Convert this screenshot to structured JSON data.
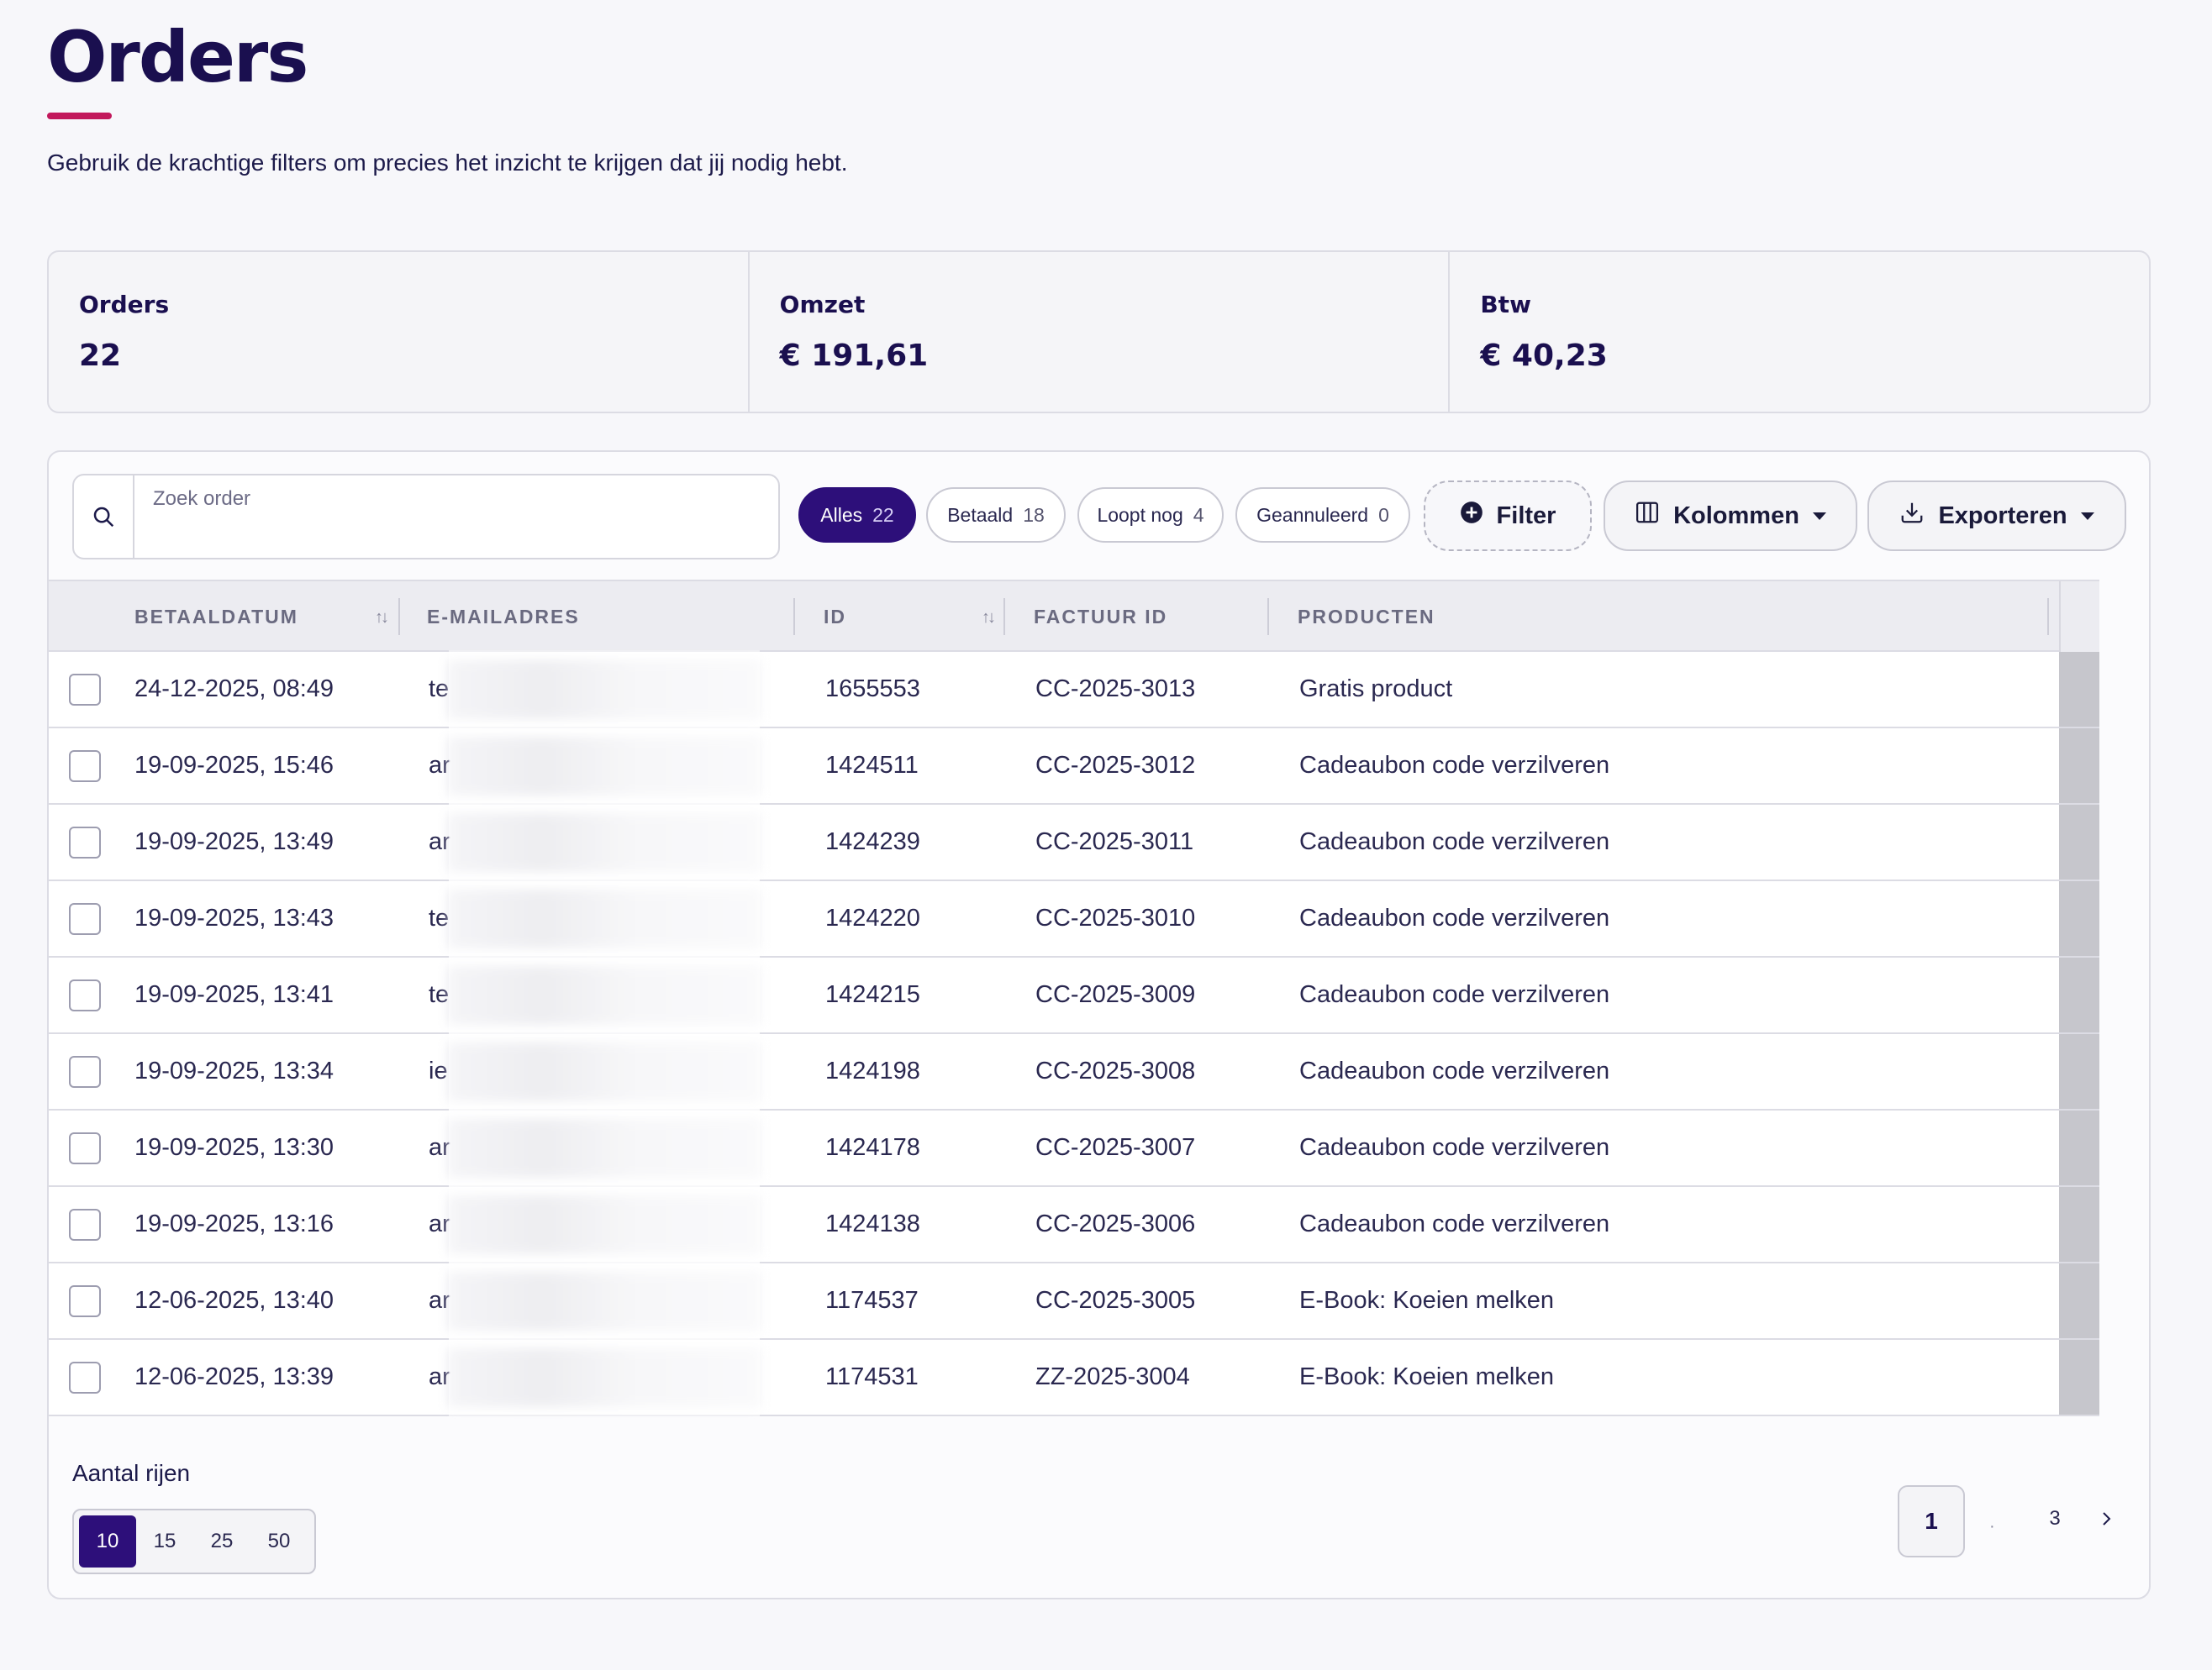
{
  "page": {
    "title": "Orders",
    "subtitle": "Gebruik de krachtige filters om precies het inzicht te krijgen dat jij nodig hebt."
  },
  "stats": [
    {
      "label": "Orders",
      "value": "22"
    },
    {
      "label": "Omzet",
      "value": "€ 191,61"
    },
    {
      "label": "Btw",
      "value": "€ 40,23"
    }
  ],
  "search": {
    "placeholder": "Zoek order"
  },
  "filters": [
    {
      "label": "Alles",
      "count": "22",
      "active": true
    },
    {
      "label": "Betaald",
      "count": "18",
      "active": false
    },
    {
      "label": "Loopt nog",
      "count": "4",
      "active": false
    },
    {
      "label": "Geannuleerd",
      "count": "0",
      "active": false
    }
  ],
  "toolbar": {
    "filter_label": "Filter",
    "columns_label": "Kolommen",
    "export_label": "Exporteren"
  },
  "table": {
    "headers": {
      "date": "BETAALDATUM",
      "email": "E-MAILADRES",
      "id": "ID",
      "invoice": "FACTUUR ID",
      "products": "PRODUCTEN"
    },
    "rows": [
      {
        "date": "24-12-2025, 08:49",
        "email": "te",
        "id": "1655553",
        "invoice": "CC-2025-3013",
        "product": "Gratis product"
      },
      {
        "date": "19-09-2025, 15:46",
        "email": "ar",
        "id": "1424511",
        "invoice": "CC-2025-3012",
        "product": "Cadeaubon code verzilveren"
      },
      {
        "date": "19-09-2025, 13:49",
        "email": "ar",
        "id": "1424239",
        "invoice": "CC-2025-3011",
        "product": "Cadeaubon code verzilveren"
      },
      {
        "date": "19-09-2025, 13:43",
        "email": "te",
        "id": "1424220",
        "invoice": "CC-2025-3010",
        "product": "Cadeaubon code verzilveren"
      },
      {
        "date": "19-09-2025, 13:41",
        "email": "te",
        "id": "1424215",
        "invoice": "CC-2025-3009",
        "product": "Cadeaubon code verzilveren"
      },
      {
        "date": "19-09-2025, 13:34",
        "email": "ie",
        "id": "1424198",
        "invoice": "CC-2025-3008",
        "product": "Cadeaubon code verzilveren"
      },
      {
        "date": "19-09-2025, 13:30",
        "email": "ar",
        "id": "1424178",
        "invoice": "CC-2025-3007",
        "product": "Cadeaubon code verzilveren"
      },
      {
        "date": "19-09-2025, 13:16",
        "email": "ar",
        "id": "1424138",
        "invoice": "CC-2025-3006",
        "product": "Cadeaubon code verzilveren"
      },
      {
        "date": "12-06-2025, 13:40",
        "email": "ar",
        "id": "1174537",
        "invoice": "CC-2025-3005",
        "product": "E-Book: Koeien melken"
      },
      {
        "date": "12-06-2025, 13:39",
        "email": "ar",
        "id": "1174531",
        "invoice": "ZZ-2025-3004",
        "product": "E-Book: Koeien melken"
      }
    ]
  },
  "footer": {
    "rows_label": "Aantal rijen",
    "row_options": [
      "10",
      "15",
      "25",
      "50"
    ],
    "selected_rows": "10",
    "pagination": {
      "current": "1",
      "dot": "·",
      "last": "3"
    }
  },
  "colors": {
    "accent": "#2d0f7a",
    "title": "#1a0f4f",
    "underline": "#c2185b"
  }
}
